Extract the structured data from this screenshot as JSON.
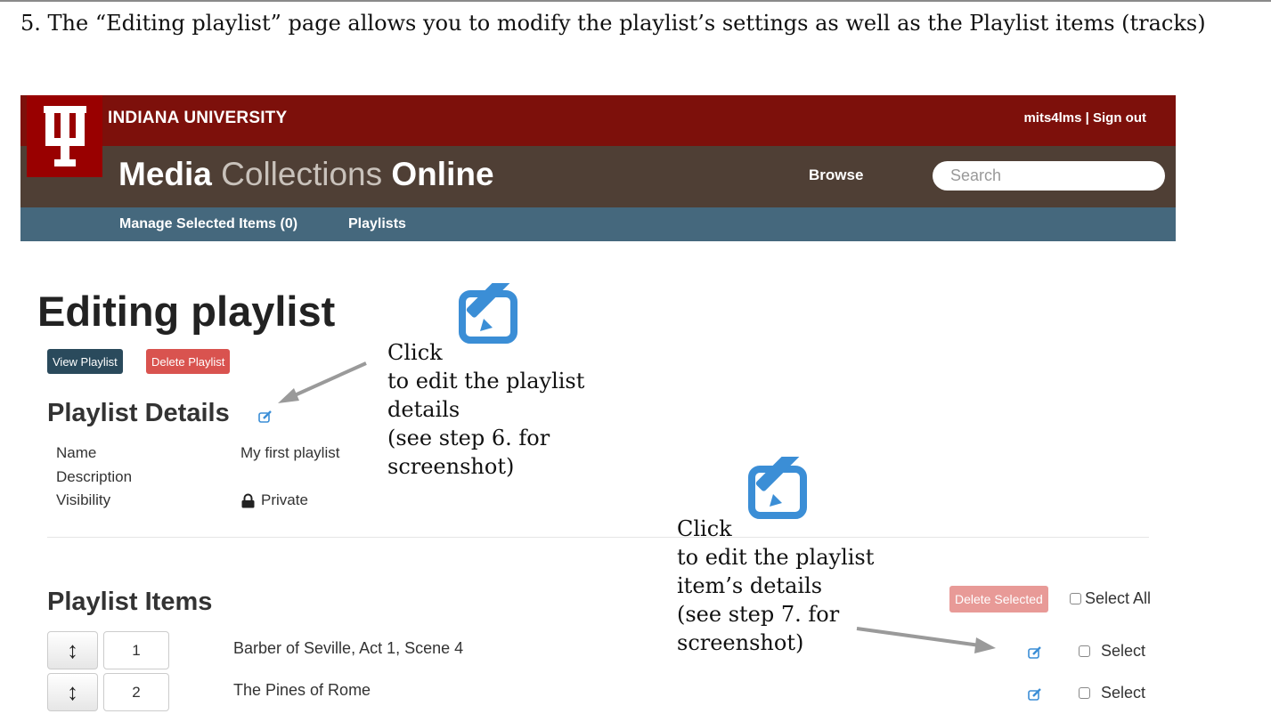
{
  "doc": {
    "caption": "5. The “Editing playlist” page allows you to modify the playlist’s settings as well as the Playlist items (tracks)"
  },
  "header": {
    "university": "INDIANA UNIVERSITY",
    "user_links": "mits4lms | Sign out",
    "title_part1": "Media",
    "title_part2": "Collections",
    "title_part3": "Online",
    "browse": "Browse",
    "search_placeholder": "Search",
    "nav": {
      "manage_selected": "Manage Selected Items (0)",
      "playlists": "Playlists"
    }
  },
  "page": {
    "title": "Editing playlist",
    "view_button": "View Playlist",
    "delete_button": "Delete Playlist",
    "details_heading": "Playlist Details",
    "details": [
      {
        "label": "Name",
        "value": "My first playlist"
      },
      {
        "label": "Description",
        "value": ""
      },
      {
        "label": "Visibility",
        "value": "Private"
      }
    ],
    "items_heading": "Playlist Items",
    "delete_selected": "Delete Selected",
    "select_all": "Select All",
    "items": [
      {
        "position": "1",
        "title": "Barber of Seville, Act 1, Scene 4",
        "select_label": "Select"
      },
      {
        "position": "2",
        "title": "The Pines of Rome",
        "select_label": "Select"
      }
    ]
  },
  "annotations": {
    "details": [
      "Click",
      "to edit the playlist",
      "details",
      "(see step 6. for",
      "screenshot)"
    ],
    "items": [
      "Click",
      "to edit the playlist",
      "item’s details",
      "(see step 7. for",
      "screenshot)"
    ]
  },
  "colors": {
    "red_band": "#7d100b",
    "brown_band": "#4f3f35",
    "blue_band": "#45687d",
    "edit_icon": "#3b8ed6",
    "danger": "#d9534f",
    "dark_button": "#2a4a5c"
  }
}
